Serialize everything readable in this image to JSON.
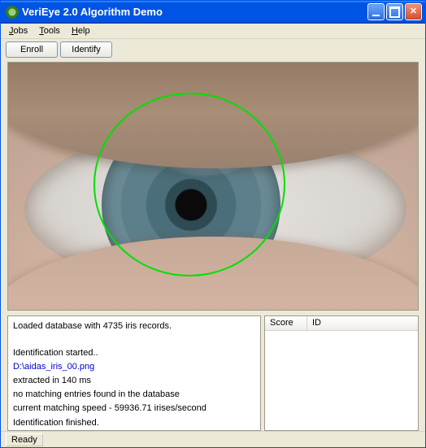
{
  "window": {
    "title": "VeriEye 2.0 Algorithm Demo"
  },
  "menubar": {
    "items": [
      "Jobs",
      "Tools",
      "Help"
    ]
  },
  "toolbar": {
    "enroll_label": "Enroll",
    "identify_label": "Identify"
  },
  "log": {
    "line0": "Loaded database with 4735 iris records.",
    "line1": "Identification started..",
    "line2": "D:\\aidas_iris_00.png",
    "line3": "extracted in 140 ms",
    "line4": "no matching entries found in the database",
    "line5": "current matching speed - 59936.71 irises/second",
    "line6": "Identification finished."
  },
  "results": {
    "columns": {
      "score": "Score",
      "id": "ID"
    },
    "rows": []
  },
  "statusbar": {
    "text": "Ready"
  }
}
